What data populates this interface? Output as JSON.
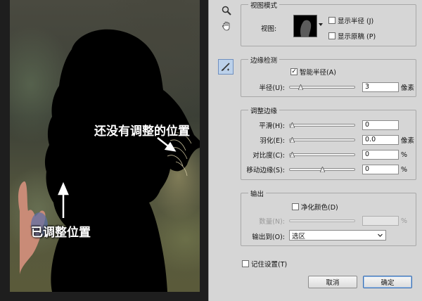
{
  "annotations": {
    "not_adjusted": "还没有调整的位置",
    "adjusted": "已调整位置"
  },
  "toolbar": {
    "zoom_icon": "magnifier-icon",
    "hand_icon": "hand-icon",
    "refine_brush_icon": "refine-radius-brush-icon"
  },
  "view_mode": {
    "legend": "视图模式",
    "view_label": "视图:",
    "show_radius": "显示半径 (J)",
    "show_original": "显示原稿 (P)",
    "show_radius_checked": false,
    "show_original_checked": false
  },
  "edge_detection": {
    "legend": "边缘检测",
    "smart_radius": "智能半径(A)",
    "smart_radius_checked": true,
    "radius_label": "半径(U):",
    "radius_value": "3",
    "radius_unit": "像素"
  },
  "adjust_edge": {
    "legend": "调整边缘",
    "smooth_label": "平滑(H):",
    "smooth_value": "0",
    "feather_label": "羽化(E):",
    "feather_value": "0.0",
    "feather_unit": "像素",
    "contrast_label": "对比度(C):",
    "contrast_value": "0",
    "contrast_unit": "%",
    "shift_label": "移动边缘(S):",
    "shift_value": "0",
    "shift_unit": "%"
  },
  "output": {
    "legend": "输出",
    "decontaminate": "净化颜色(D)",
    "decontaminate_checked": false,
    "amount_label": "数量(N):",
    "amount_unit": "%",
    "output_to_label": "输出到(O):",
    "output_to_value": "选区"
  },
  "remember_settings": "记住设置(T)",
  "remember_checked": false,
  "buttons": {
    "cancel": "取消",
    "ok": "确定"
  },
  "colors": {
    "dialog_bg": "#d6d6d6",
    "active_tool": "#bcd1ea",
    "default_button": "#3c6fb0"
  }
}
